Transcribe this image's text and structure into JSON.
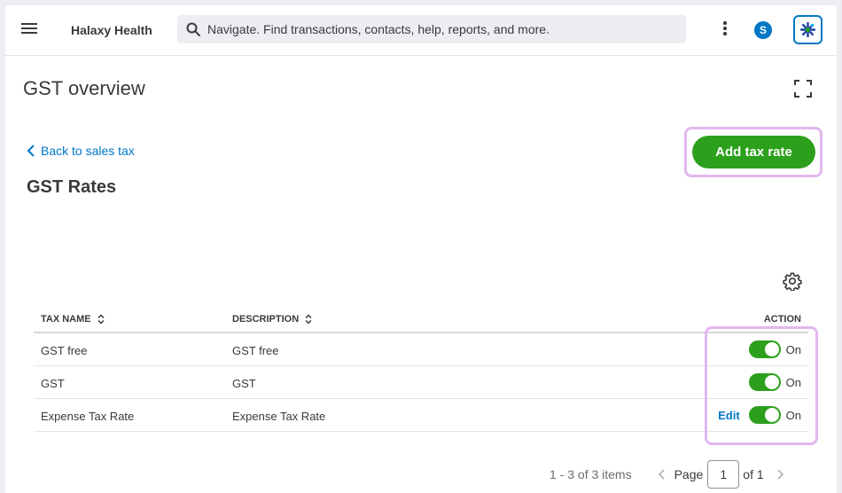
{
  "header": {
    "company_name": "Halaxy Health",
    "search_placeholder": "Navigate. Find transactions, contacts, help, reports, and more.",
    "avatar_initial": "S",
    "icons": [
      "hamburger-menu-icon",
      "search-icon",
      "more-vertical-icon",
      "assistant-icon"
    ]
  },
  "page": {
    "title": "GST overview",
    "expand_icon": "fullscreen-icon"
  },
  "content": {
    "back_link": "Back to sales tax",
    "section_title": "GST Rates",
    "add_button": "Add tax rate",
    "settings_icon": "gear-icon"
  },
  "table": {
    "columns": {
      "tax_name": "TAX NAME",
      "description": "DESCRIPTION",
      "action": "ACTION"
    },
    "rows": [
      {
        "tax_name": "GST free",
        "description": "GST free",
        "edit": "",
        "status": "On"
      },
      {
        "tax_name": "GST",
        "description": "GST",
        "edit": "",
        "status": "On"
      },
      {
        "tax_name": "Expense Tax Rate",
        "description": "Expense Tax Rate",
        "edit": "Edit",
        "status": "On"
      }
    ]
  },
  "pagination": {
    "range": "1 - 3 of 3 items",
    "page_label": "Page",
    "current_page": "1",
    "of_label": "of 1"
  },
  "colors": {
    "primary_green": "#2ca01c",
    "link_blue": "#0077c5",
    "highlight": "#e3b7f0"
  }
}
